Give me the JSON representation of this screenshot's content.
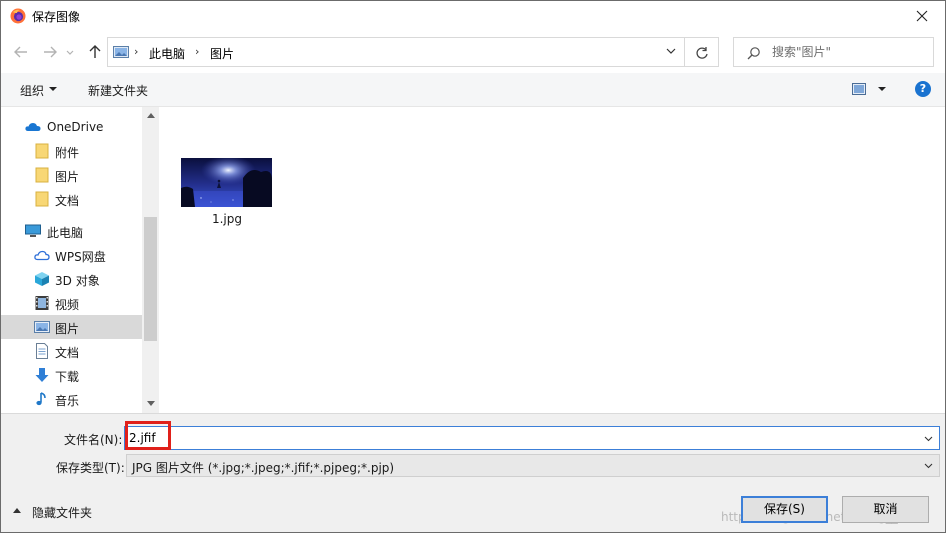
{
  "window": {
    "title": "保存图像",
    "close_icon": "close-icon"
  },
  "address": {
    "crumbs": [
      "此电脑",
      "图片"
    ],
    "search_placeholder": "搜索\"图片\""
  },
  "toolbar": {
    "organize_label": "组织",
    "new_folder_label": "新建文件夹",
    "help_label": "?"
  },
  "sidebar": {
    "items": [
      {
        "label": "OneDrive",
        "icon": "cloud-icon"
      },
      {
        "label": "附件",
        "icon": "folder-icon"
      },
      {
        "label": "图片",
        "icon": "folder-icon"
      },
      {
        "label": "文档",
        "icon": "folder-icon"
      },
      {
        "label": "此电脑",
        "icon": "computer-icon"
      },
      {
        "label": "WPS网盘",
        "icon": "cloud-drive-icon"
      },
      {
        "label": "3D 对象",
        "icon": "cube-icon"
      },
      {
        "label": "视频",
        "icon": "video-icon"
      },
      {
        "label": "图片",
        "icon": "pictures-icon",
        "selected": true
      },
      {
        "label": "文档",
        "icon": "document-icon"
      },
      {
        "label": "下载",
        "icon": "download-icon"
      },
      {
        "label": "音乐",
        "icon": "music-icon"
      }
    ]
  },
  "files": [
    {
      "name": "1.jpg",
      "icon": "image-thumbnail"
    }
  ],
  "form": {
    "filename_label": "文件名(N):",
    "filename_value": "2.jfif",
    "type_label": "保存类型(T):",
    "type_value": "JPG 图片文件 (*.jpg;*.jpeg;*.jfif;*.pjpeg;*.pjp)",
    "hide_folders_label": "隐藏文件夹",
    "save_label": "保存(S)",
    "cancel_label": "取消"
  },
  "colors": {
    "accent": "#3c7fd8",
    "highlight_box": "#e0201a",
    "selected_nav": "#d9d9d9"
  }
}
